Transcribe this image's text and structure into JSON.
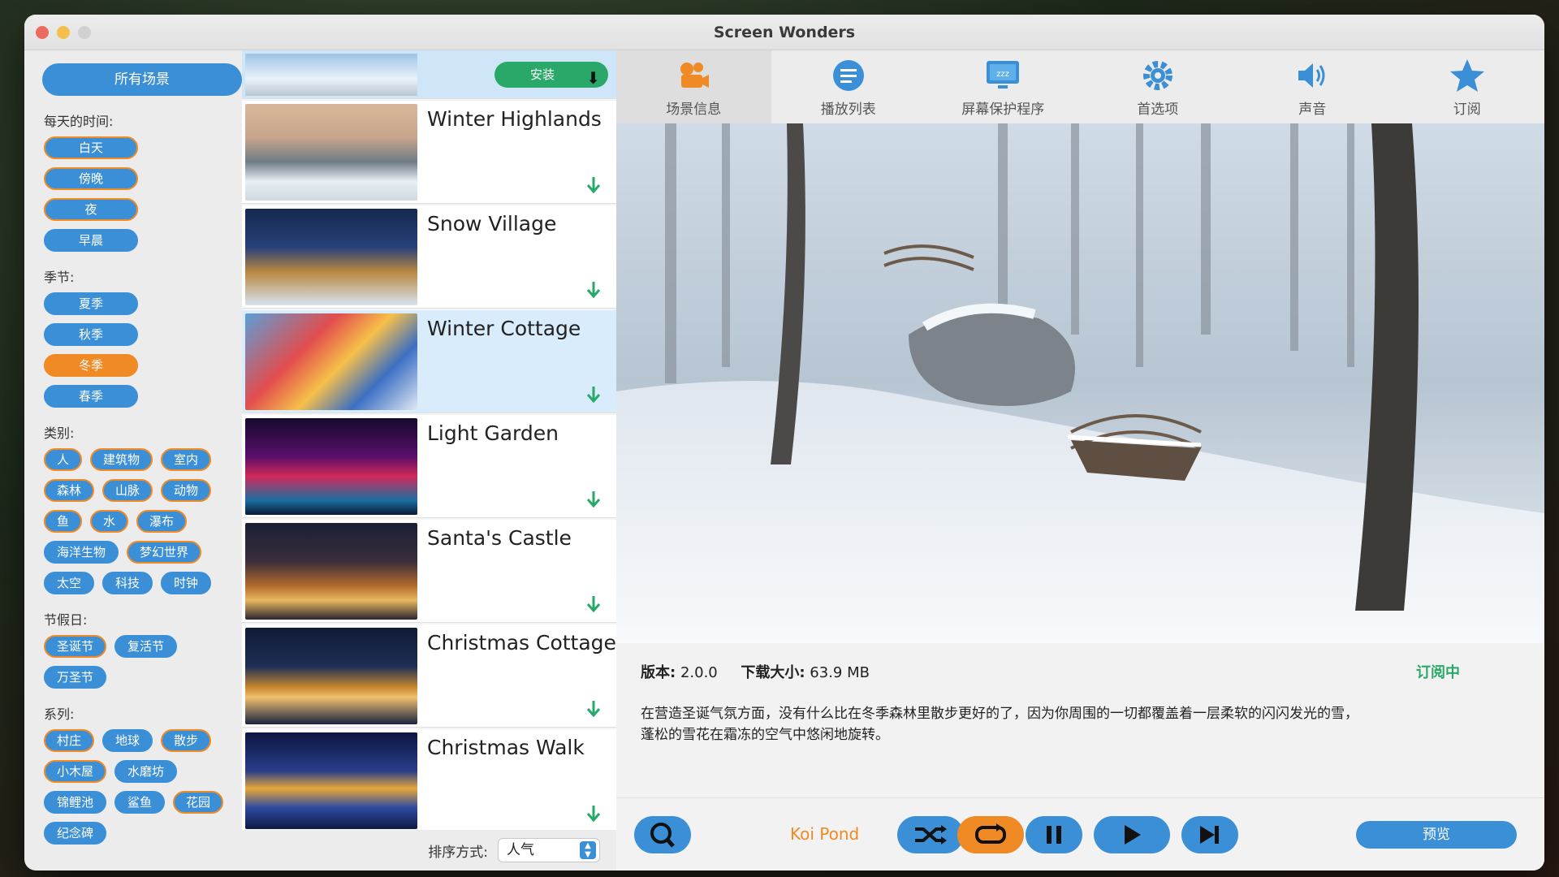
{
  "window": {
    "title": "Screen Wonders"
  },
  "sidebar": {
    "all_scenes": "所有场景",
    "time_label": "每天的时间:",
    "time_tags": [
      "白天",
      "傍晚",
      "夜",
      "早晨"
    ],
    "season_label": "季节:",
    "season_tags": [
      "夏季",
      "秋季",
      "冬季",
      "春季"
    ],
    "category_label": "类别:",
    "category_tags": [
      "人",
      "建筑物",
      "室内",
      "森林",
      "山脉",
      "动物",
      "鱼",
      "水",
      "瀑布",
      "海洋生物",
      "梦幻世界",
      "太空",
      "科技",
      "时钟"
    ],
    "holiday_label": "节假日:",
    "holiday_tags": [
      "圣诞节",
      "复活节",
      "万圣节"
    ],
    "series_label": "系列:",
    "series_tags": [
      "村庄",
      "地球",
      "散步",
      "小木屋",
      "水磨坊",
      "锦鲤池",
      "鲨鱼",
      "花园",
      "纪念碑"
    ]
  },
  "list": {
    "install_label": "安装",
    "items": [
      {
        "title": "Winter Highlands"
      },
      {
        "title": "Snow Village"
      },
      {
        "title": "Winter Cottage"
      },
      {
        "title": "Light Garden"
      },
      {
        "title": "Santa's Castle"
      },
      {
        "title": "Christmas Cottage"
      },
      {
        "title": "Christmas Walk"
      }
    ],
    "sort_label": "排序方式:",
    "sort_value": "人气"
  },
  "toolbar": {
    "tabs": [
      {
        "label": "场景信息",
        "icon": "camera-icon"
      },
      {
        "label": "播放列表",
        "icon": "playlist-icon"
      },
      {
        "label": "屏幕保护程序",
        "icon": "screensaver-icon"
      },
      {
        "label": "首选项",
        "icon": "gear-icon"
      },
      {
        "label": "声音",
        "icon": "speaker-icon"
      },
      {
        "label": "订阅",
        "icon": "star-icon"
      }
    ]
  },
  "details": {
    "version_label": "版本:",
    "version": "2.0.0",
    "size_label": "下载大小:",
    "size": "63.9 MB",
    "status": "订阅中",
    "description": "在营造圣诞气氛方面，没有什么比在冬季森林里散步更好的了，因为你周围的一切都覆盖着一层柔软的闪闪发光的雪，蓬松的雪花在霜冻的空气中悠闲地旋转。"
  },
  "player": {
    "now_playing": "Koi Pond",
    "preview_label": "预览"
  },
  "colors": {
    "accent": "#3b8fd6",
    "orange": "#f08a24",
    "green": "#2aa86a"
  }
}
